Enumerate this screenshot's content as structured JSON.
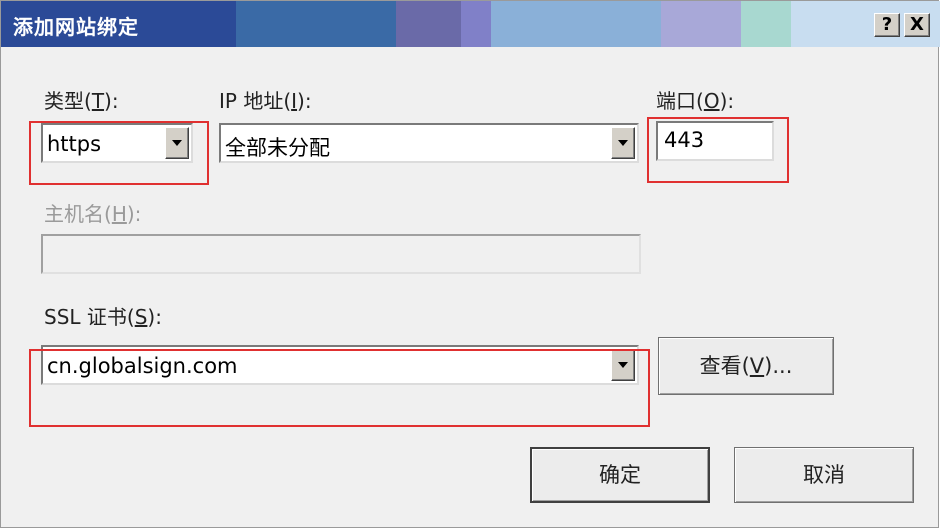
{
  "dialog": {
    "title": "添加网站绑定",
    "help_button": "?",
    "close_button": "X"
  },
  "type_field": {
    "label": "类型(",
    "hotkey": "T",
    "label_end": "):",
    "value": "https"
  },
  "ip_field": {
    "label": "IP 地址(",
    "hotkey": "I",
    "label_end": "):",
    "value": "全部未分配"
  },
  "port_field": {
    "label": "端口(",
    "hotkey": "O",
    "label_end": "):",
    "value": "443"
  },
  "hostname_field": {
    "label": "主机名(",
    "hotkey": "H",
    "label_end": "):",
    "value": ""
  },
  "ssl_field": {
    "label": "SSL 证书(",
    "hotkey": "S",
    "label_end": "):",
    "value": "cn.globalsign.com"
  },
  "view_button": {
    "label": "查看(",
    "hotkey": "V",
    "label_end": ")..."
  },
  "ok_button": {
    "label": "确定"
  },
  "cancel_button": {
    "label": "取消"
  },
  "colors": {
    "highlight": "#e03030",
    "title_text": "#ffffff"
  }
}
